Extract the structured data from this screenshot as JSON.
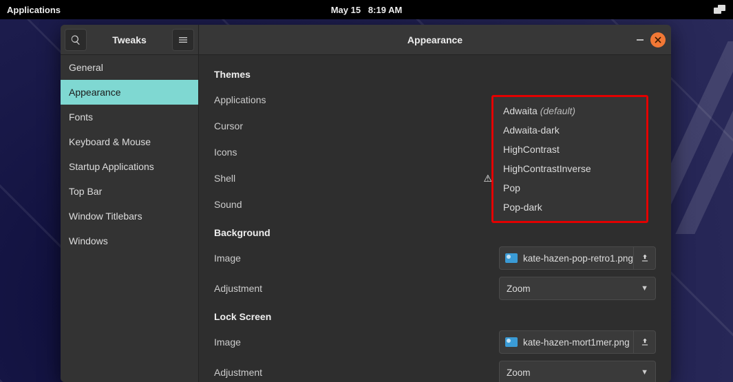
{
  "topbar": {
    "applications_label": "Applications",
    "date": "May 15",
    "time": "8:19 AM"
  },
  "window": {
    "app_title": "Tweaks",
    "header_title": "Appearance"
  },
  "sidebar": {
    "items": [
      {
        "label": "General"
      },
      {
        "label": "Appearance"
      },
      {
        "label": "Fonts"
      },
      {
        "label": "Keyboard & Mouse"
      },
      {
        "label": "Startup Applications"
      },
      {
        "label": "Top Bar"
      },
      {
        "label": "Window Titlebars"
      },
      {
        "label": "Windows"
      }
    ],
    "active_index": 1
  },
  "sections": {
    "themes": {
      "title": "Themes",
      "rows": {
        "applications": "Applications",
        "cursor": "Cursor",
        "icons": "Icons",
        "shell": "Shell",
        "sound": "Sound"
      }
    },
    "background": {
      "title": "Background",
      "image_label": "Image",
      "image_file": "kate-hazen-pop-retro1.png",
      "adjustment_label": "Adjustment",
      "adjustment_value": "Zoom"
    },
    "lockscreen": {
      "title": "Lock Screen",
      "image_label": "Image",
      "image_file": "kate-hazen-mort1mer.png",
      "adjustment_label": "Adjustment",
      "adjustment_value": "Zoom"
    }
  },
  "popup": {
    "items": [
      {
        "label": "Adwaita",
        "suffix": "(default)"
      },
      {
        "label": "Adwaita-dark"
      },
      {
        "label": "HighContrast"
      },
      {
        "label": "HighContrastInverse"
      },
      {
        "label": "Pop"
      },
      {
        "label": "Pop-dark"
      }
    ]
  }
}
